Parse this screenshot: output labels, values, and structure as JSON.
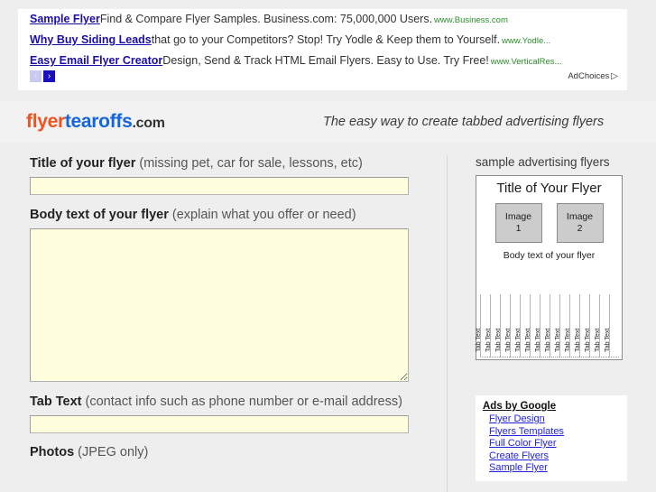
{
  "ad_banner": {
    "ads": [
      {
        "title": "Sample Flyer",
        "description": "Find & Compare Flyer Samples. Business.com: 75,000,000 Users.",
        "url": "www.Business.com"
      },
      {
        "title": "Why Buy Siding Leads",
        "description": "that go to your Competitors? Stop! Try Yodle & Keep them to Yourself.",
        "url": "www.Yodle..."
      },
      {
        "title": "Easy Email Flyer Creator",
        "description": "Design, Send & Track HTML Email Flyers. Easy to Use. Try Free!",
        "url": "www.VerticalRes..."
      }
    ],
    "prev_arrow": "‹",
    "next_arrow": "›",
    "adchoices_label": "AdChoices",
    "adchoices_glyph": "▷",
    "link_color": "#1a0dab",
    "url_color": "#2b8c2b"
  },
  "header": {
    "logo_part1": "flyer",
    "logo_part2": "tearoffs",
    "logo_part3": ".com",
    "logo_color1": "#f4511e",
    "logo_color2": "#1565e0",
    "tagline": "The easy way to create tabbed advertising flyers"
  },
  "form": {
    "fields": [
      {
        "label_strong": "Title of your flyer",
        "label_hint": " (missing pet, car for sale, lessons, etc)",
        "value": "",
        "placeholder": ""
      },
      {
        "label_strong": "Body text of your flyer",
        "label_hint": " (explain what you offer or need)",
        "value": "",
        "placeholder": ""
      },
      {
        "label_strong": "Tab Text",
        "label_hint": " (contact info such as phone number or e-mail address)",
        "value": "",
        "placeholder": ""
      },
      {
        "label_strong": "Photos",
        "label_hint": " (JPEG only)",
        "value": "",
        "placeholder": ""
      }
    ],
    "input_bg": "#ffffdd"
  },
  "sidebar": {
    "heading": "sample advertising flyers",
    "preview": {
      "title": "Title of Your Flyer",
      "image1_line1": "Image",
      "image1_line2": "1",
      "image2_line1": "Image",
      "image2_line2": "2",
      "body_text": "Body text of your flyer",
      "tab_label": "Tab Text",
      "tab_count": 14
    }
  },
  "google_ads": {
    "title": "Ads by Google",
    "links": [
      "Flyer Design",
      "Flyers Templates",
      "Full Color Flyer",
      "Create Flyers",
      "Sample Flyer"
    ],
    "link_color": "#2222dd"
  }
}
